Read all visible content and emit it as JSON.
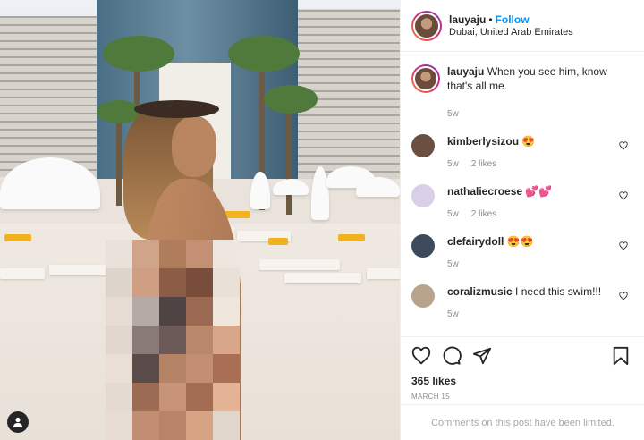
{
  "post": {
    "author": "lauyaju",
    "separator": "•",
    "follow_label": "Follow",
    "location": "Dubai, United Arab Emirates"
  },
  "caption": {
    "username": "lauyaju",
    "text": "When you see him, know that's all me.",
    "time": "5w"
  },
  "comments": [
    {
      "username": "kimberlysizou",
      "text": "😍",
      "time": "5w",
      "likes": "2 likes",
      "avatar_color": "#6b4f40"
    },
    {
      "username": "nathaliecroese",
      "text": "💕💕",
      "time": "5w",
      "likes": "2 likes",
      "avatar_color": "#d9cfe6"
    },
    {
      "username": "clefairydoll",
      "text": "😍😍",
      "time": "5w",
      "likes": "",
      "avatar_color": "#3d4a5c"
    },
    {
      "username": "coralizmusic",
      "text": "I need this swim!!!",
      "time": "5w",
      "likes": "",
      "avatar_color": "#b8a48c"
    }
  ],
  "actions": {
    "like_icon": "heart-icon",
    "comment_icon": "comment-icon",
    "share_icon": "share-icon",
    "save_icon": "bookmark-icon"
  },
  "likes": "365 likes",
  "date": "MARCH 15",
  "comments_limited": "Comments on this post have been limited.",
  "colors": {
    "follow": "#0095f6",
    "muted": "#8e8e8e",
    "text": "#262626"
  }
}
